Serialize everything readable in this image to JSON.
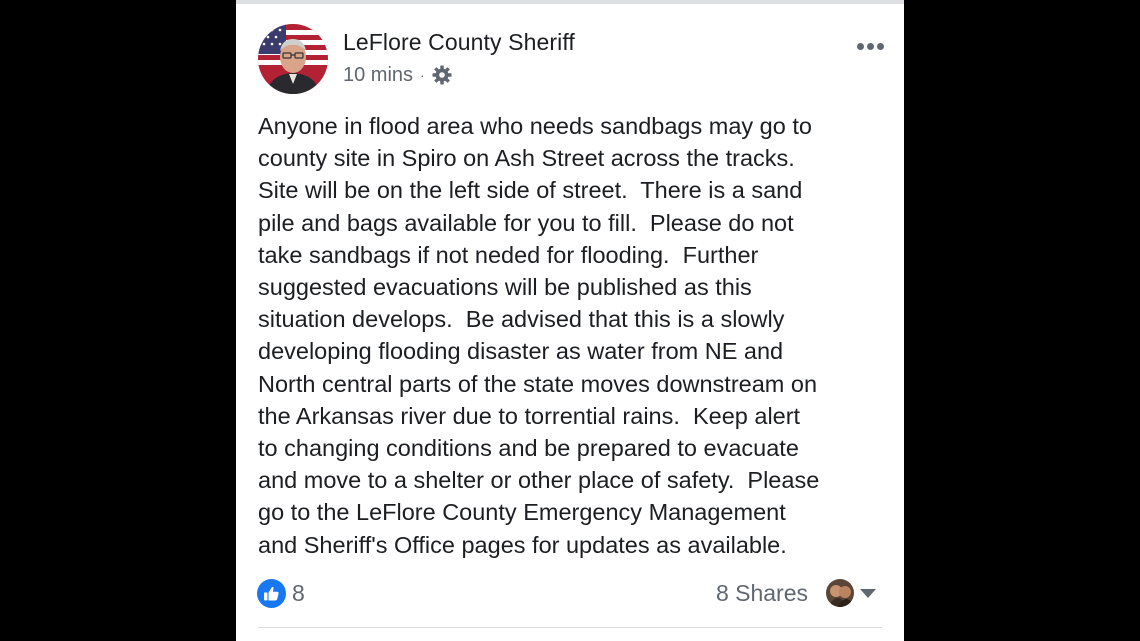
{
  "post": {
    "author": "LeFlore County Sheriff",
    "timestamp": "10 mins",
    "separator": "·",
    "audience_icon": "gear-icon",
    "more_icon": "more-options-icon",
    "text_lines": [
      "Anyone in flood area who needs sandbags may go to",
      "county site in Spiro on Ash Street across the tracks.",
      "Site will be on the left side of street.  There is a sand",
      "pile and bags available for you to fill.  Please do not",
      "take sandbags if not neded for flooding.  Further",
      "suggested evacuations will be published as this",
      "situation develops.  Be advised that this is a slowly",
      "developing flooding disaster as water from NE and",
      "North central parts of the state moves downstream on",
      "the Arkansas river due to torrential rains.  Keep alert",
      "to changing conditions and be prepared to evacuate",
      "and move to a shelter or other place of safety.  Please",
      "go to the LeFlore County Emergency Management",
      "and Sheriff's Office pages for updates as available."
    ]
  },
  "footer": {
    "like_icon": "thumbs-up-icon",
    "like_count": "8",
    "shares_label": "8 Shares",
    "share_menu_icon": "caret-down-icon"
  },
  "colors": {
    "background": "#000000",
    "card": "#ffffff",
    "text": "#1c1e21",
    "secondary_text": "#606770",
    "like_blue": "#1877f2"
  }
}
